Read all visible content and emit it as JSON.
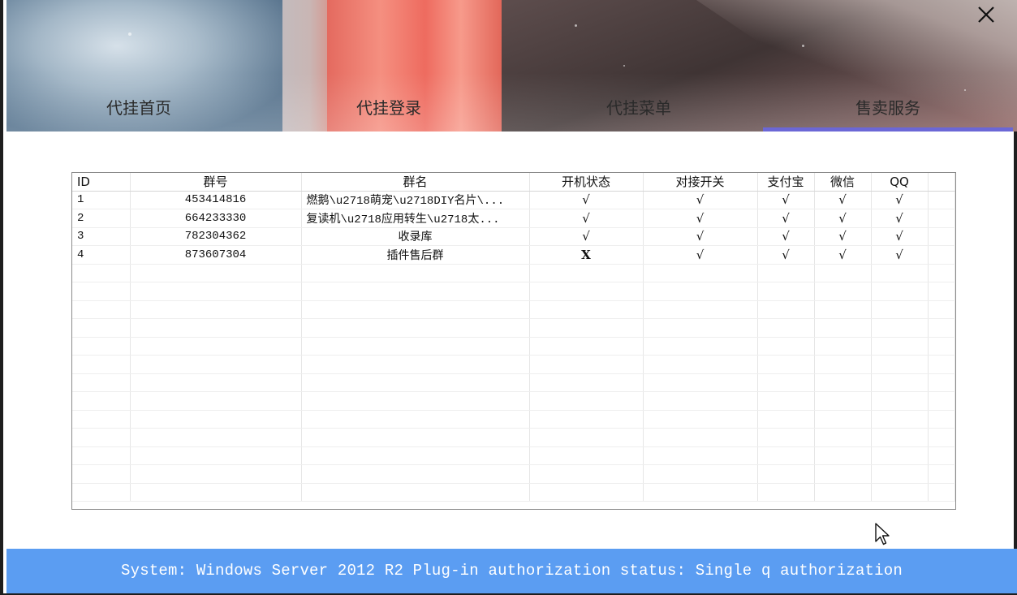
{
  "nav": {
    "tabs": [
      {
        "label": "代挂首页",
        "active": false
      },
      {
        "label": "代挂登录",
        "active": false
      },
      {
        "label": "代挂菜单",
        "active": false
      },
      {
        "label": "售卖服务",
        "active": true
      }
    ],
    "close_icon": "close-icon"
  },
  "table": {
    "columns": [
      "ID",
      "群号",
      "群名",
      "开机状态",
      "对接开关",
      "支付宝",
      "微信",
      "QQ"
    ],
    "rows": [
      {
        "id": "1",
        "group_no": "453414816",
        "group_name": "燃鹅\\u2718萌宠\\u2718DIY名片\\...",
        "boot": "√",
        "dock": "√",
        "alipay": "√",
        "wechat": "√",
        "qq": "√"
      },
      {
        "id": "2",
        "group_no": "664233330",
        "group_name": "复读机\\u2718应用转生\\u2718太...",
        "boot": "√",
        "dock": "√",
        "alipay": "√",
        "wechat": "√",
        "qq": "√"
      },
      {
        "id": "3",
        "group_no": "782304362",
        "group_name": "收录库",
        "boot": "√",
        "dock": "√",
        "alipay": "√",
        "wechat": "√",
        "qq": "√"
      },
      {
        "id": "4",
        "group_no": "873607304",
        "group_name": "插件售后群",
        "boot": "X",
        "dock": "√",
        "alipay": "√",
        "wechat": "√",
        "qq": "√"
      }
    ]
  },
  "status_bar": {
    "text": "System:  Windows Server 2012 R2  Plug-in authorization status:  Single q authorization"
  },
  "colors": {
    "status_bar_bg": "#5b9df2",
    "active_tab_underline": "#6b67d6"
  }
}
